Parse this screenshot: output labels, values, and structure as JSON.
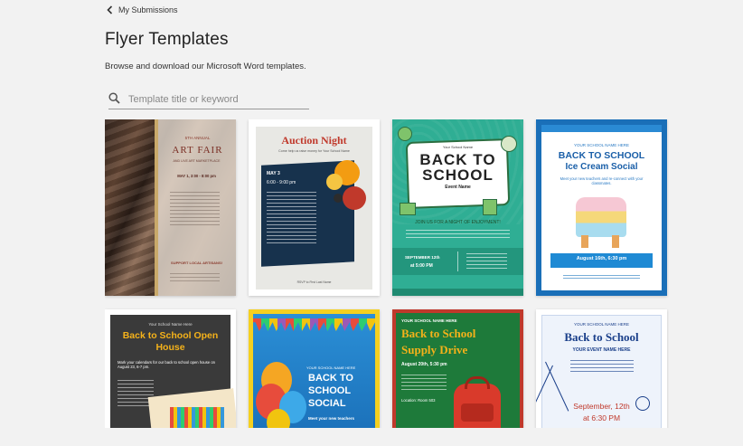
{
  "nav": {
    "back_label": "My Submissions"
  },
  "page": {
    "title": "Flyer Templates",
    "subtitle": "Browse and download our Microsoft Word templates."
  },
  "search": {
    "placeholder": "Template title or keyword",
    "value": ""
  },
  "templates": [
    {
      "id": "art-fair",
      "small": "5TH ANNUAL",
      "title": "ART FAIR",
      "line2": "AND LIVE ART MARKETPLACE",
      "date": "MAY 1, 3:00 - 8:00 pm",
      "footer": "SUPPORT LOCAL ARTISANS!"
    },
    {
      "id": "auction-night",
      "title": "Auction Night",
      "tagline": "Come help us raise money for Your School Name",
      "date": "MAY 3",
      "time": "6:00 - 9:00 pm",
      "footer": "RSVP to First Last Name"
    },
    {
      "id": "back-to-school",
      "school": "Your School Name",
      "title_line1": "BACK TO",
      "title_line2": "SCHOOL",
      "event": "Event Name",
      "cta": "JOIN US FOR A NIGHT OF ENJOYMENT!",
      "date": "SEPTEMBER 12th",
      "time": "at 5:00 PM"
    },
    {
      "id": "ice-cream-social",
      "school": "YOUR SCHOOL NAME HERE",
      "title_line1": "BACK TO SCHOOL",
      "title_line2": "Ice Cream Social",
      "text": "Meet your new teachers and re-connect with your classmates.",
      "date": "August 16th, 6:30 pm"
    },
    {
      "id": "open-house",
      "school": "Your School Name Here",
      "title": "Back to School Open House",
      "text": "Mark your calendars for our back to school open house on August 23, 6-7 pm."
    },
    {
      "id": "school-social",
      "school": "YOUR SCHOOL NAME HERE",
      "title_line1": "BACK TO",
      "title_line2": "SCHOOL",
      "title_line3": "SOCIAL",
      "text": "Meet your new teachers"
    },
    {
      "id": "supply-drive",
      "school": "YOUR SCHOOL NAME HERE",
      "title_line1": "Back to School",
      "title_line2": "Supply Drive",
      "date": "August 20th, 5:30 pm",
      "location": "Location: Room 503"
    },
    {
      "id": "your-event",
      "school": "YOUR SCHOOL NAME HERE",
      "title": "Back to School",
      "event": "YOUR EVENT NAME HERE",
      "date": "September, 12th",
      "time": "at 6:30 PM"
    }
  ]
}
